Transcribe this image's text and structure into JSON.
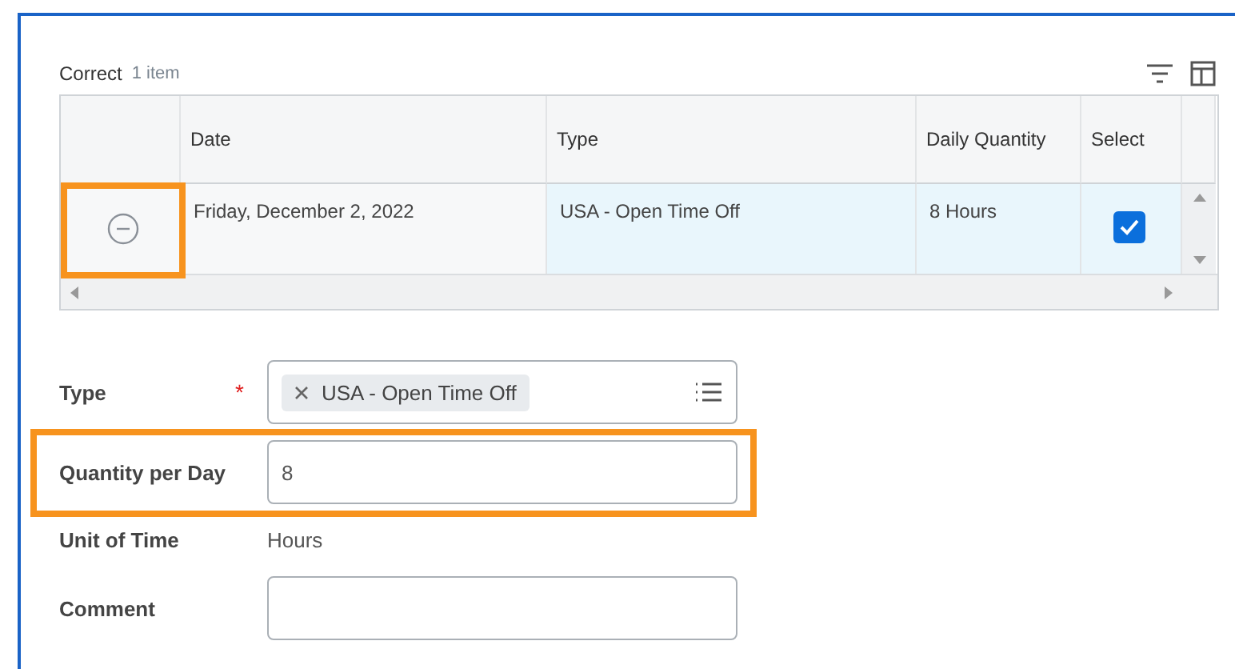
{
  "section": {
    "title": "Correct",
    "count": "1 item"
  },
  "table": {
    "columns": [
      "Date",
      "Type",
      "Daily Quantity",
      "Select"
    ],
    "rows": [
      {
        "highlighted": true,
        "date": "Friday, December 2, 2022",
        "type": "USA - Open Time Off",
        "quantity": "8 Hours",
        "checked": true
      }
    ]
  },
  "form": [
    {
      "kind": "tags",
      "label": "Type",
      "required_mark": "*",
      "highlighted": false,
      "tags": [
        "USA - Open Time Off"
      ]
    },
    {
      "kind": "input",
      "label": "Quantity per Day",
      "highlighted": true,
      "value": "8"
    },
    {
      "kind": "text",
      "label": "Unit of Time",
      "highlighted": false,
      "value": "Hours"
    },
    {
      "kind": "input",
      "label": "Comment",
      "highlighted": false
    }
  ]
}
